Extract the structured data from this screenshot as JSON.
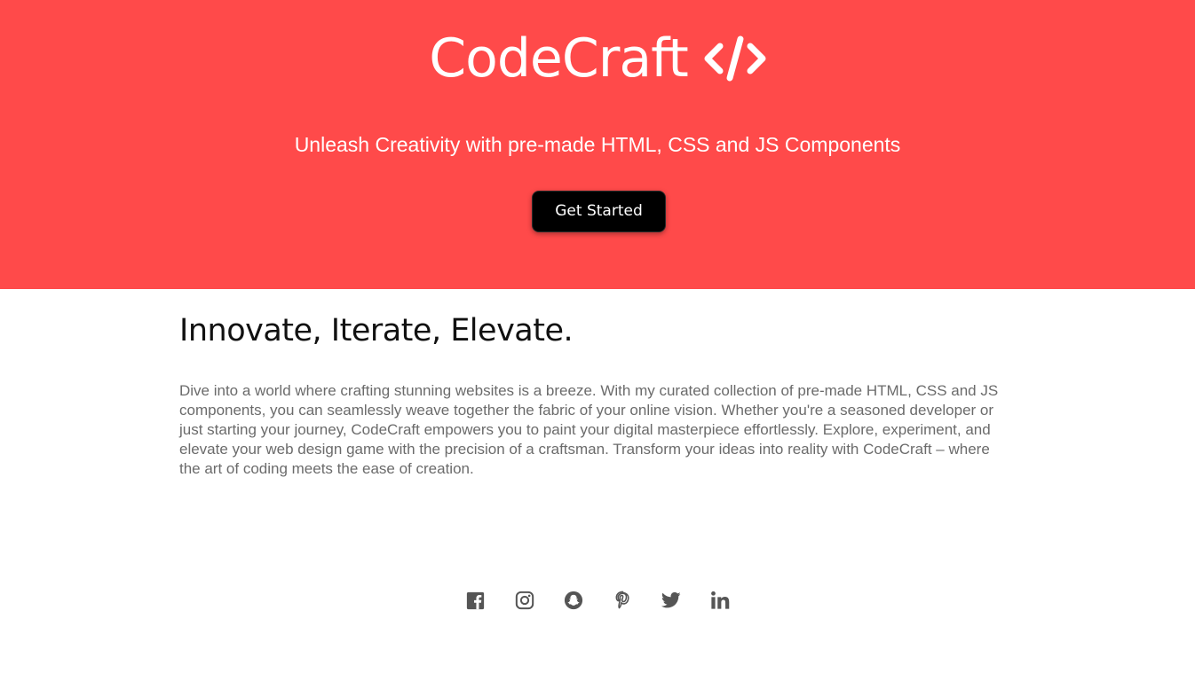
{
  "hero": {
    "brand_name": "CodeCraft",
    "tagline": "Unleash Creativity with pre-made HTML, CSS and JS Components",
    "cta_label": "Get Started",
    "background_color": "#ff4a4a"
  },
  "main": {
    "heading": "Innovate, Iterate, Elevate.",
    "body": "Dive into a world where crafting stunning websites is a breeze. With my curated collection of pre-made HTML, CSS and JS components, you can seamlessly weave together the fabric of your online vision. Whether you're a seasoned developer or just starting your journey, CodeCraft empowers you to paint your digital masterpiece effortlessly. Explore, experiment, and elevate your web design game with the precision of a craftsman. Transform your ideas into reality with CodeCraft – where the art of coding meets the ease of creation."
  },
  "social": {
    "icons": [
      "facebook-icon",
      "instagram-icon",
      "snapchat-icon",
      "pinterest-icon",
      "twitter-icon",
      "linkedin-icon"
    ],
    "icon_color": "#555555"
  }
}
